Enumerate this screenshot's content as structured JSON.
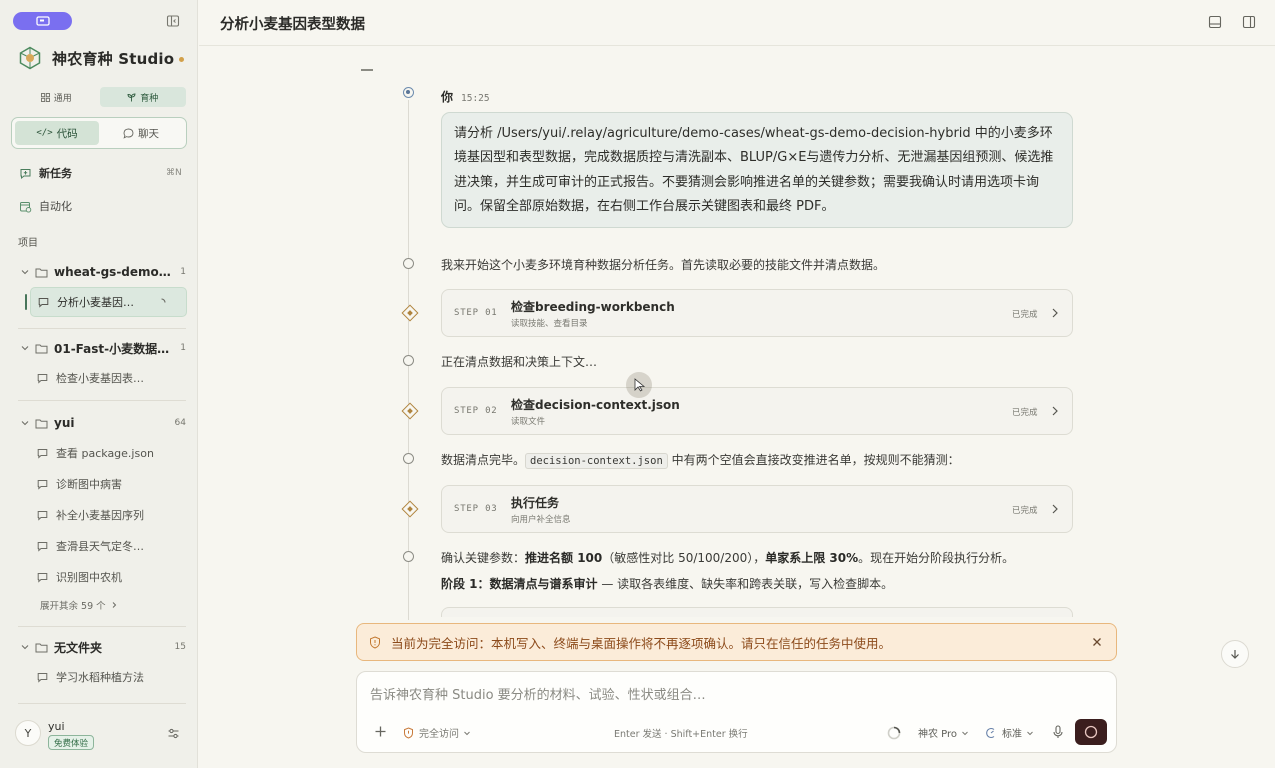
{
  "sidebar": {
    "brand_name": "神农育种 Studio",
    "segments": {
      "general": "通用",
      "breeding": "育种"
    },
    "modes": {
      "code": "代码",
      "chat": "聊天"
    },
    "new_task": {
      "label": "新任务",
      "shortcut": "⌘N"
    },
    "automation": "自动化",
    "projects_label": "项目",
    "groups": [
      {
        "name": "wheat-gs-demo…",
        "count": "1",
        "items": [
          "分析小麦基因…"
        ]
      },
      {
        "name": "01-Fast-小麦数据…",
        "count": "1",
        "items": [
          "检查小麦基因表…"
        ]
      },
      {
        "name": "yui",
        "count": "64",
        "items": [
          "查看 package.json",
          "诊断图中病害",
          "补全小麦基因序列",
          "查滑县天气定冬…",
          "识别图中农机"
        ]
      },
      {
        "name": "无文件夹",
        "count": "15",
        "items": [
          "学习水稻种植方法"
        ]
      }
    ],
    "expand_more": "展开其余 59 个",
    "user": {
      "avatar_letter": "Y",
      "name": "yui",
      "badge": "免费体验"
    }
  },
  "topbar": {
    "title": "分析小麦基因表型数据"
  },
  "conversation": {
    "user_label": "你",
    "user_time": "15:25",
    "user_message": "请分析 /Users/yui/.relay/agriculture/demo-cases/wheat-gs-demo-decision-hybrid 中的小麦多环境基因型和表型数据，完成数据质控与清洗副本、BLUP/G×E与遗传力分析、无泄漏基因组预测、候选推进决策，并生成可审计的正式报告。不要猜测会影响推进名单的关键参数；需要我确认时请用选项卡询问。保留全部原始数据，在右侧工作台展示关键图表和最终 PDF。",
    "msg1": "我来开始这个小麦多环境育种数据分析任务。首先读取必要的技能文件并清点数据。",
    "steps": [
      {
        "num": "STEP 01",
        "title": "检查breeding-workbench",
        "sub": "读取技能、查看目录",
        "status": "已完成"
      },
      {
        "num": "STEP 02",
        "title": "检查decision-context.json",
        "sub": "读取文件",
        "status": "已完成"
      },
      {
        "num": "STEP 03",
        "title": "执行任务",
        "sub": "向用户补全信息",
        "status": "已完成"
      }
    ],
    "msg2": "正在清点数据和决策上下文…",
    "msg3_prefix": "数据清点完毕。",
    "msg3_code": "decision-context.json",
    "msg3_suffix": "中有两个空值会直接改变推进名单，按规则不能猜测：",
    "msg4_a": "确认关键参数：",
    "msg4_b": "推进名额 100",
    "msg4_c": "（敏感性对比 50/100/200），",
    "msg4_d": "单家系上限 30%",
    "msg4_e": "。现在开始分阶段执行分析。",
    "msg5_a": "阶段 1：数据清点与谱系审计",
    "msg5_b": " — 读取各表维度、缺失率和跨表关联，写入检查脚本。"
  },
  "warning": {
    "text": "当前为完全访问：本机写入、终端与桌面操作将不再逐项确认。请只在信任的任务中使用。"
  },
  "composer": {
    "placeholder": "告诉神农育种 Studio 要分析的材料、试验、性状或组合…",
    "access": "完全访问",
    "hint": "Enter 发送 · Shift+Enter 换行",
    "model": "神农 Pro",
    "level": "标准"
  },
  "colors": {
    "accent": "#7a6ff0",
    "green": "#48755a",
    "warning_bg": "#fbecd9",
    "warning_text": "#8c4a1a",
    "send": "#3b1e1e"
  }
}
